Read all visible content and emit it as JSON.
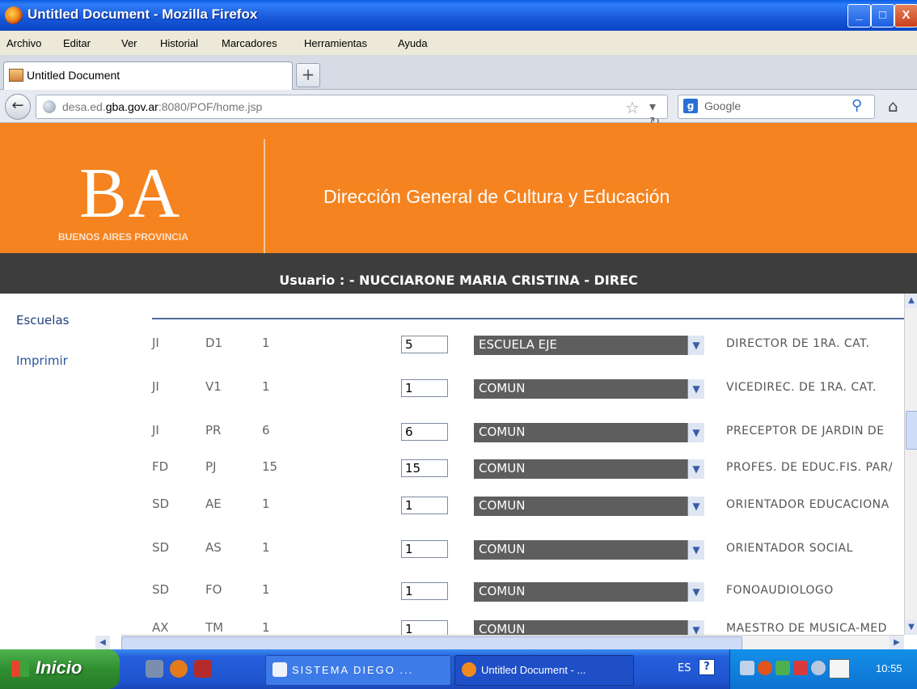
{
  "window": {
    "title": "Untitled Document - Mozilla Firefox",
    "minimize": "_",
    "maximize": "□",
    "close": "X"
  },
  "menu": [
    "Archivo",
    "Editar",
    "Ver",
    "Historial",
    "Marcadores",
    "Herramientas",
    "Ayuda"
  ],
  "tab": {
    "label": "Untitled Document",
    "newtab": "+"
  },
  "nav": {
    "url_prefix": "desa.ed.",
    "url_host": "gba.gov.ar",
    "url_suffix": ":8080/POF/home.jsp",
    "search_placeholder": "Google"
  },
  "header": {
    "logo": "BA",
    "logo_sub": "BUENOS AIRES PROVINCIA",
    "title": "Dirección General de Cultura y Educación"
  },
  "user_bar": {
    "text": "Usuario : - NUCCIARONE MARIA CRISTINA - DIREC"
  },
  "sidebar": {
    "items": [
      "Escuelas",
      "Imprimir"
    ]
  },
  "rows": [
    {
      "c1": "JI",
      "c2": "D1",
      "c3": "1",
      "qty": "5",
      "select": "ESCUELA EJE",
      "desc": "DIRECTOR DE 1RA. CAT."
    },
    {
      "c1": "JI",
      "c2": "V1",
      "c3": "1",
      "qty": "1",
      "select": "COMUN",
      "desc": "VICEDIREC. DE 1RA. CAT."
    },
    {
      "c1": "JI",
      "c2": "PR",
      "c3": "6",
      "qty": "6",
      "select": "COMUN",
      "desc": "PRECEPTOR DE JARDIN DE"
    },
    {
      "c1": "FD",
      "c2": "PJ",
      "c3": "15",
      "qty": "15",
      "select": "COMUN",
      "desc": "PROFES. DE EDUC.FIS. PAR/"
    },
    {
      "c1": "SD",
      "c2": "AE",
      "c3": "1",
      "qty": "1",
      "select": "COMUN",
      "desc": "ORIENTADOR EDUCACIONA"
    },
    {
      "c1": "SD",
      "c2": "AS",
      "c3": "1",
      "qty": "1",
      "select": "COMUN",
      "desc": "ORIENTADOR SOCIAL"
    },
    {
      "c1": "SD",
      "c2": "FO",
      "c3": "1",
      "qty": "1",
      "select": "COMUN",
      "desc": "FONOAUDIOLOGO"
    },
    {
      "c1": "AX",
      "c2": "TM",
      "c3": "1",
      "qty": "1",
      "select": "COMUN",
      "desc": "MAESTRO DE MUSICA-MED"
    }
  ],
  "taskbar": {
    "start": "Inicio",
    "tasks": [
      "SISTEMA DIEGO ...",
      "Untitled Document - ..."
    ],
    "lang": "ES",
    "clock": "10:55"
  },
  "colors": {
    "header_orange": "#f5831f",
    "user_bar": "#3d3d3d",
    "select_bg": "#5e5e5e"
  }
}
